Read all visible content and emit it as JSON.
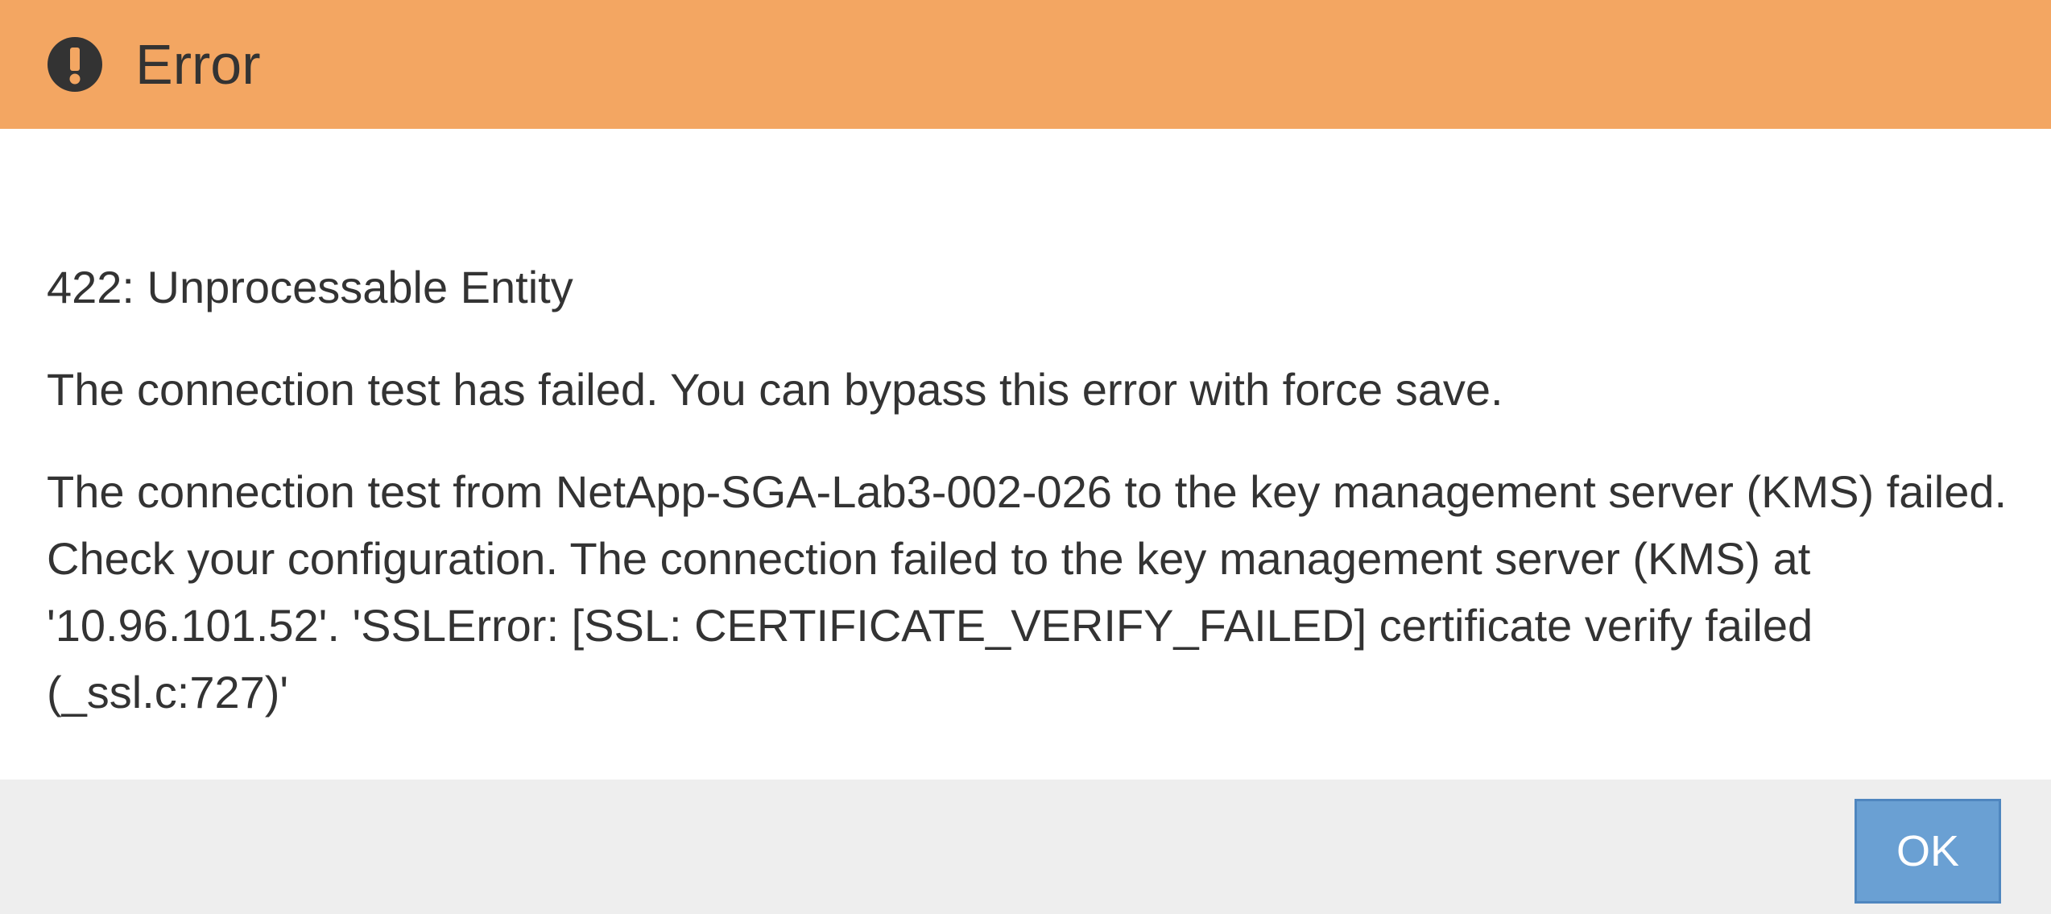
{
  "dialog": {
    "title": "Error",
    "icon": "exclamation-circle-icon",
    "header_color": "#f3a662",
    "status": "422: Unprocessable Entity",
    "summary": "The connection test has failed. You can bypass this error with force save.",
    "detail_lines": [
      "The connection test from NetApp-SGA-Lab3-002-026 to the key management server (KMS) failed.",
      "Check your configuration. The connection failed to the key management server (KMS) at",
      "'10.96.101.52'. 'SSLError: [SSL: CERTIFICATE_VERIFY_FAILED] certificate verify failed",
      "(_ssl.c:727)'"
    ],
    "ok_label": "OK",
    "ok_color": "#6aa0d3"
  }
}
